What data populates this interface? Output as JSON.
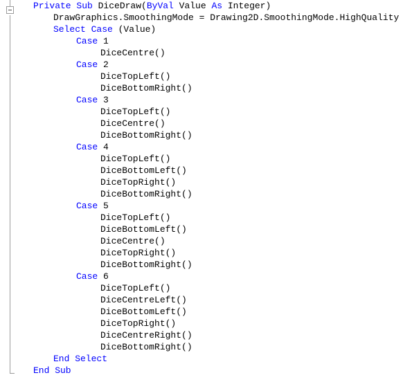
{
  "editor": {
    "language": "Visual Basic",
    "background_color": "#ffffff",
    "keyword_color": "#0000ff",
    "text_color": "#000000",
    "gutter_line_color": "#9a9a9a"
  },
  "gutter": {
    "fold_toggle_state": "expanded",
    "fold_toggle_glyph": "minus-box-icon"
  },
  "code": {
    "lines": [
      {
        "indent": 1,
        "segments": [
          {
            "text": "Private Sub ",
            "kind": "keyword"
          },
          {
            "text": "DiceDraw(",
            "kind": "plain"
          },
          {
            "text": "ByVal ",
            "kind": "keyword"
          },
          {
            "text": "Value ",
            "kind": "plain"
          },
          {
            "text": "As ",
            "kind": "keyword"
          },
          {
            "text": "Integer)",
            "kind": "plain"
          }
        ]
      },
      {
        "indent": 2,
        "segments": [
          {
            "text": "DrawGraphics.SmoothingMode = Drawing2D.SmoothingMode.HighQuality",
            "kind": "plain"
          }
        ]
      },
      {
        "indent": 2,
        "segments": [
          {
            "text": "Select Case ",
            "kind": "keyword"
          },
          {
            "text": "(Value)",
            "kind": "plain"
          }
        ]
      },
      {
        "indent": 3,
        "segments": [
          {
            "text": "Case ",
            "kind": "keyword"
          },
          {
            "text": "1",
            "kind": "plain"
          }
        ]
      },
      {
        "indent": 4,
        "segments": [
          {
            "text": "DiceCentre()",
            "kind": "plain"
          }
        ]
      },
      {
        "indent": 3,
        "segments": [
          {
            "text": "Case ",
            "kind": "keyword"
          },
          {
            "text": "2",
            "kind": "plain"
          }
        ]
      },
      {
        "indent": 4,
        "segments": [
          {
            "text": "DiceTopLeft()",
            "kind": "plain"
          }
        ]
      },
      {
        "indent": 4,
        "segments": [
          {
            "text": "DiceBottomRight()",
            "kind": "plain"
          }
        ]
      },
      {
        "indent": 3,
        "segments": [
          {
            "text": "Case ",
            "kind": "keyword"
          },
          {
            "text": "3",
            "kind": "plain"
          }
        ]
      },
      {
        "indent": 4,
        "segments": [
          {
            "text": "DiceTopLeft()",
            "kind": "plain"
          }
        ]
      },
      {
        "indent": 4,
        "segments": [
          {
            "text": "DiceCentre()",
            "kind": "plain"
          }
        ]
      },
      {
        "indent": 4,
        "segments": [
          {
            "text": "DiceBottomRight()",
            "kind": "plain"
          }
        ]
      },
      {
        "indent": 3,
        "segments": [
          {
            "text": "Case ",
            "kind": "keyword"
          },
          {
            "text": "4",
            "kind": "plain"
          }
        ]
      },
      {
        "indent": 4,
        "segments": [
          {
            "text": "DiceTopLeft()",
            "kind": "plain"
          }
        ]
      },
      {
        "indent": 4,
        "segments": [
          {
            "text": "DiceBottomLeft()",
            "kind": "plain"
          }
        ]
      },
      {
        "indent": 4,
        "segments": [
          {
            "text": "DiceTopRight()",
            "kind": "plain"
          }
        ]
      },
      {
        "indent": 4,
        "segments": [
          {
            "text": "DiceBottomRight()",
            "kind": "plain"
          }
        ]
      },
      {
        "indent": 3,
        "segments": [
          {
            "text": "Case ",
            "kind": "keyword"
          },
          {
            "text": "5",
            "kind": "plain"
          }
        ]
      },
      {
        "indent": 4,
        "segments": [
          {
            "text": "DiceTopLeft()",
            "kind": "plain"
          }
        ]
      },
      {
        "indent": 4,
        "segments": [
          {
            "text": "DiceBottomLeft()",
            "kind": "plain"
          }
        ]
      },
      {
        "indent": 4,
        "segments": [
          {
            "text": "DiceCentre()",
            "kind": "plain"
          }
        ]
      },
      {
        "indent": 4,
        "segments": [
          {
            "text": "DiceTopRight()",
            "kind": "plain"
          }
        ]
      },
      {
        "indent": 4,
        "segments": [
          {
            "text": "DiceBottomRight()",
            "kind": "plain"
          }
        ]
      },
      {
        "indent": 3,
        "segments": [
          {
            "text": "Case ",
            "kind": "keyword"
          },
          {
            "text": "6",
            "kind": "plain"
          }
        ]
      },
      {
        "indent": 4,
        "segments": [
          {
            "text": "DiceTopLeft()",
            "kind": "plain"
          }
        ]
      },
      {
        "indent": 4,
        "segments": [
          {
            "text": "DiceCentreLeft()",
            "kind": "plain"
          }
        ]
      },
      {
        "indent": 4,
        "segments": [
          {
            "text": "DiceBottomLeft()",
            "kind": "plain"
          }
        ]
      },
      {
        "indent": 4,
        "segments": [
          {
            "text": "DiceTopRight()",
            "kind": "plain"
          }
        ]
      },
      {
        "indent": 4,
        "segments": [
          {
            "text": "DiceCentreRight()",
            "kind": "plain"
          }
        ]
      },
      {
        "indent": 4,
        "segments": [
          {
            "text": "DiceBottomRight()",
            "kind": "plain"
          }
        ]
      },
      {
        "indent": 2,
        "segments": [
          {
            "text": "End Select",
            "kind": "keyword"
          }
        ]
      },
      {
        "indent": 1,
        "segments": [
          {
            "text": "End Sub",
            "kind": "keyword"
          }
        ]
      }
    ]
  }
}
